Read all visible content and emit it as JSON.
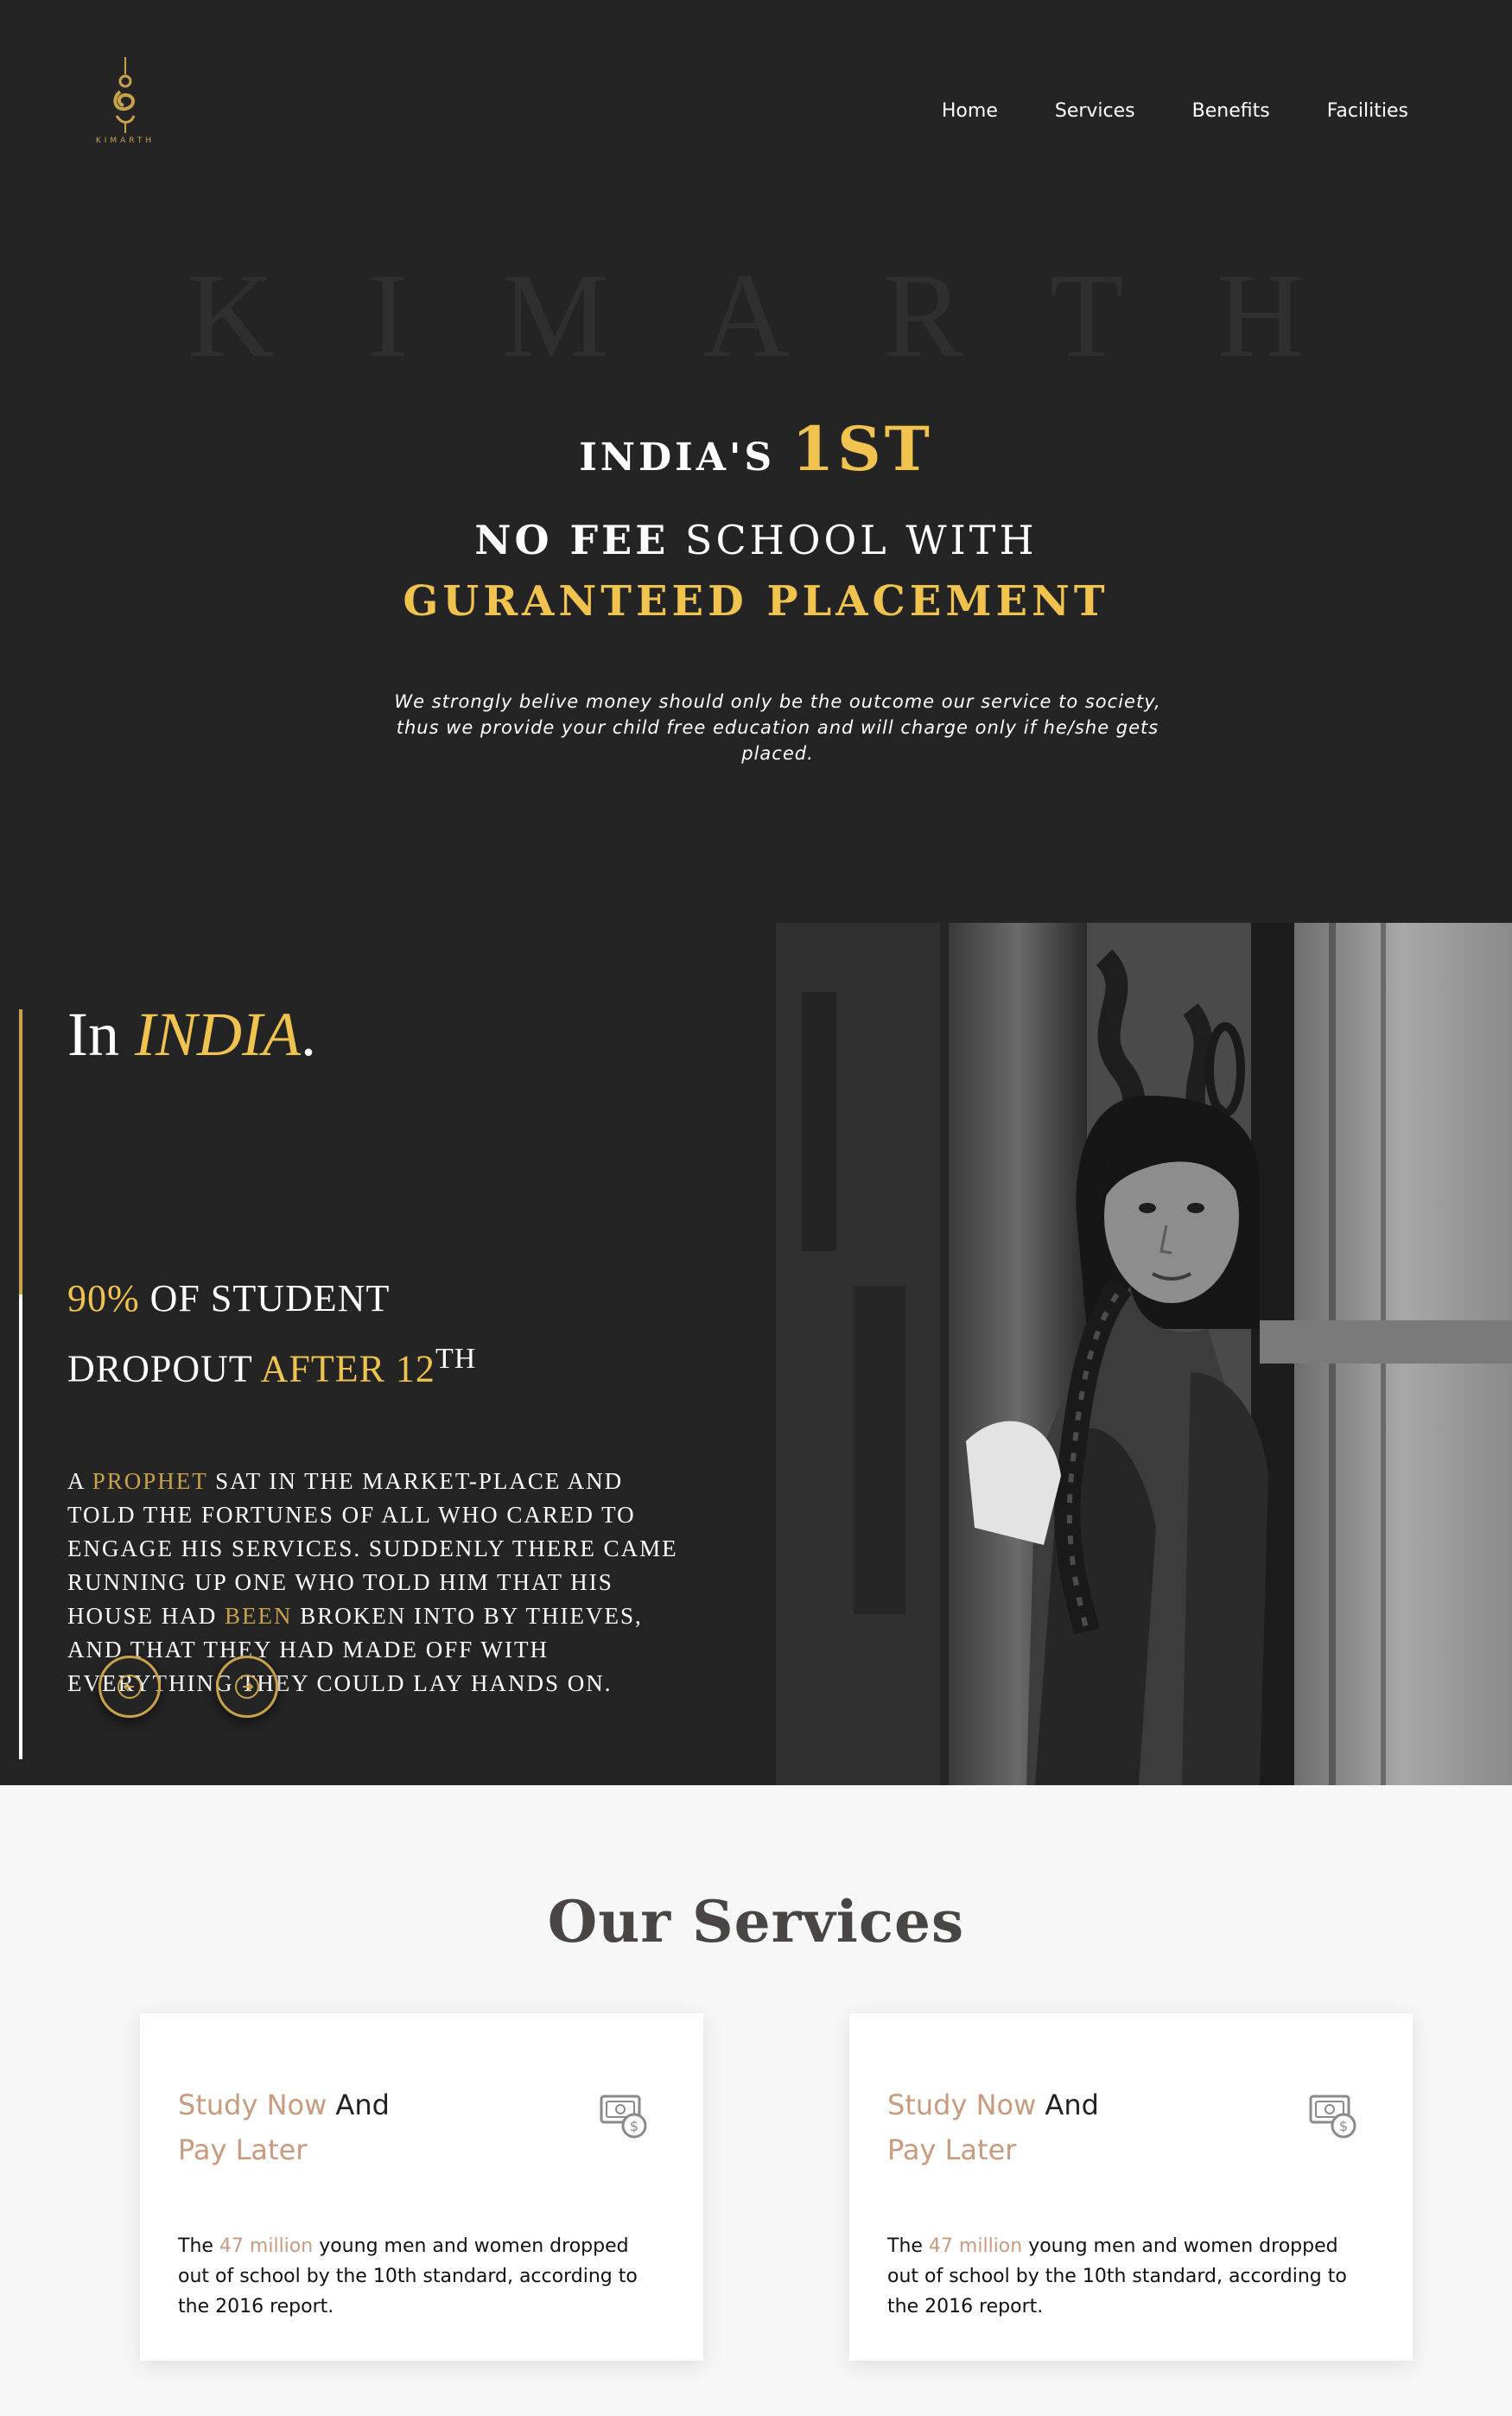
{
  "brand": {
    "logo_text": "KIMARTH",
    "watermark": "KIMARTH"
  },
  "nav": {
    "items": [
      "Home",
      "Services",
      "Benefits",
      "Facilities"
    ]
  },
  "hero": {
    "line1_prefix": "INDIA'S ",
    "line1_highlight": "1ST",
    "line2_bold": "NO FEE",
    "line2_rest": " SCHOOL WITH",
    "line3": "GURANTEED PLACEMENT",
    "tagline": "We strongly belive money should only be the outcome our service to society, thus we provide your child free education and will charge only if he/she gets placed."
  },
  "stat_section": {
    "heading_prefix": "In ",
    "heading_highlight": "INDIA",
    "heading_suffix": ".",
    "stat_percent": "90%",
    "stat_text_1": " OF STUDENT",
    "stat_text_2": "DROPOUT ",
    "stat_highlight": "AFTER 12",
    "stat_sup": "TH",
    "story_1": "A ",
    "story_hl1": "PROPHET",
    "story_2": " SAT IN THE MARKET-PLACE AND TOLD THE FORTUNES OF ALL WHO CARED TO ENGAGE HIS SERVICES. SUDDENLY THERE CAME RUNNING UP ONE WHO TOLD HIM THAT HIS HOUSE HAD ",
    "story_hl2": "BEEN",
    "story_3": " BROKEN INTO BY THIEVES, AND THAT THEY HAD MADE OFF WITH EVERYTHING THEY COULD LAY HANDS ON."
  },
  "services": {
    "title": "Our Services",
    "cards": [
      {
        "title_accent1": "Study Now",
        "title_plain": " And",
        "title_accent2": "Pay Later",
        "text_1": "The ",
        "text_accent": "47 million",
        "text_2": " young men and women dropped out of school by the 10th standard, according to the 2016 report.",
        "icon": "money-icon"
      },
      {
        "title_accent1": "Study Now",
        "title_plain": " And",
        "title_accent2": "Pay Later",
        "text_1": "The ",
        "text_accent": "47 million",
        "text_2": " young men and women dropped out of school by the 10th standard, according to the 2016 report.",
        "icon": "money-icon"
      }
    ]
  },
  "colors": {
    "dark": "#242424",
    "gold": "#f0c34e",
    "bronze": "#c9a24a",
    "accent": "#c99b7e"
  }
}
